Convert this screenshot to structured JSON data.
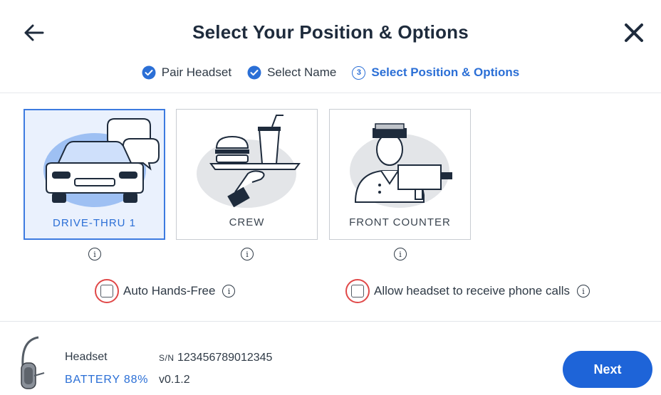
{
  "header": {
    "title": "Select Your Position & Options",
    "steps": [
      {
        "label": "Pair Headset",
        "state": "done"
      },
      {
        "label": "Select Name",
        "state": "done"
      },
      {
        "label": "Select Position & Options",
        "state": "active",
        "number": "3"
      }
    ]
  },
  "positions": [
    {
      "label": "DRIVE-THRU 1",
      "selected": true
    },
    {
      "label": "CREW",
      "selected": false
    },
    {
      "label": "FRONT COUNTER",
      "selected": false
    }
  ],
  "options": {
    "auto_hands_free": {
      "label": "Auto Hands-Free",
      "checked": false
    },
    "phone_calls": {
      "label": "Allow headset to receive phone calls",
      "checked": false
    }
  },
  "footer": {
    "device_name": "Headset",
    "sn_prefix": "S/N",
    "serial": "123456789012345",
    "battery": "BATTERY 88%",
    "version": "v0.1.2",
    "next_label": "Next"
  },
  "icons": {
    "back": "arrow-left-icon",
    "close": "close-icon",
    "step_done": "check-circle-icon",
    "info": "info-icon",
    "headset": "headset-icon"
  },
  "colors": {
    "accent": "#2b6fd6",
    "selected_bg": "#eaf1fd",
    "checkbox_highlight": "#e04848",
    "next_button": "#1e64d8"
  }
}
